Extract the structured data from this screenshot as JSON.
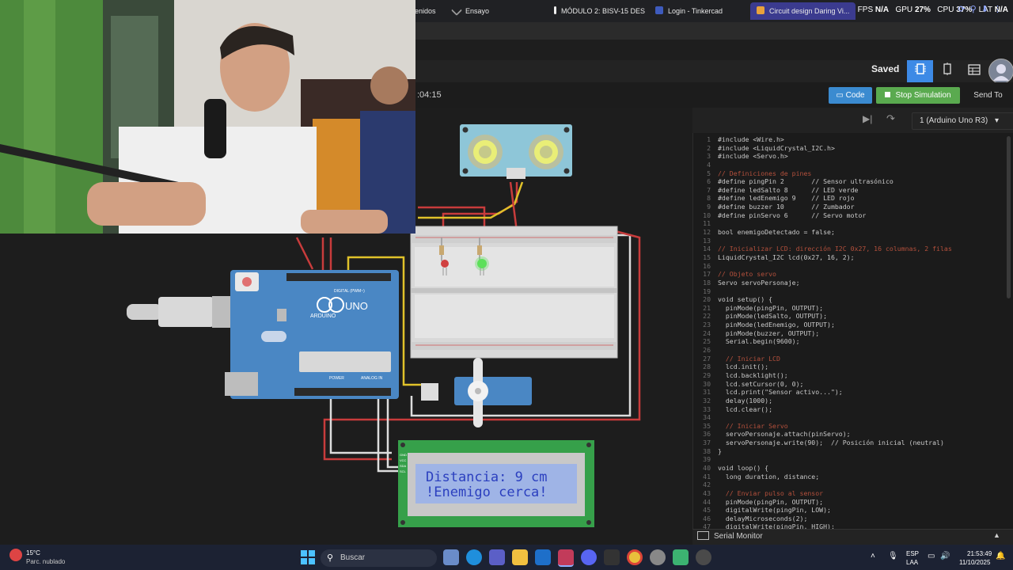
{
  "browser": {
    "tabs": [
      {
        "label": "enidos"
      },
      {
        "label": "Ensayo"
      },
      {
        "label": "MÓDULO 2: BISV-15 DES"
      },
      {
        "label": "Login - Tinkercad"
      },
      {
        "label": "Circuit design Daring Vi..."
      }
    ],
    "perf": {
      "fps_label": "FPS",
      "fps_value": "N/A",
      "gpu_label": "GPU",
      "gpu_value": "27%",
      "cpu_label": "CPU",
      "cpu_value": "37%",
      "lat_label": "LAT",
      "lat_value": "N/A"
    }
  },
  "tinkercad": {
    "saved_label": "Saved",
    "timer": ":04:15",
    "code_label": "Code",
    "stop_label": "Stop Simulation",
    "send_label": "Send To",
    "board_select": "1 (Arduino Uno R3)",
    "serial_monitor": "Serial Monitor",
    "lcd_line1": "Distancia:  9 cm",
    "lcd_line2": "!Enemigo cerca!",
    "arduino_labels": {
      "brand": "ARDUINO",
      "model": "UNO",
      "digital": "DIGITAL (PWM~)",
      "power": "POWER",
      "analog": "ANALOG IN"
    },
    "lcd_pins": [
      "GND",
      "VCC",
      "SDA",
      "SCL"
    ]
  },
  "code_lines": [
    {
      "n": "1",
      "t": "#include <Wire.h>",
      "c": false
    },
    {
      "n": "2",
      "t": "#include <LiquidCrystal_I2C.h>",
      "c": false
    },
    {
      "n": "3",
      "t": "#include <Servo.h>",
      "c": false
    },
    {
      "n": "4",
      "t": "",
      "c": false
    },
    {
      "n": "5",
      "t": "// Definiciones de pines",
      "c": true
    },
    {
      "n": "6",
      "t": "#define pingPin 2       // Sensor ultrasónico",
      "c": false
    },
    {
      "n": "7",
      "t": "#define ledSalto 8      // LED verde",
      "c": false
    },
    {
      "n": "8",
      "t": "#define ledEnemigo 9    // LED rojo",
      "c": false
    },
    {
      "n": "9",
      "t": "#define buzzer 10       // Zumbador",
      "c": false
    },
    {
      "n": "10",
      "t": "#define pinServo 6      // Servo motor",
      "c": false
    },
    {
      "n": "11",
      "t": "",
      "c": false
    },
    {
      "n": "12",
      "t": "bool enemigoDetectado = false;",
      "c": false
    },
    {
      "n": "13",
      "t": "",
      "c": false
    },
    {
      "n": "14",
      "t": "// Inicializar LCD: dirección I2C 0x27, 16 columnas, 2 filas",
      "c": true
    },
    {
      "n": "15",
      "t": "LiquidCrystal_I2C lcd(0x27, 16, 2);",
      "c": false
    },
    {
      "n": "16",
      "t": "",
      "c": false
    },
    {
      "n": "17",
      "t": "// Objeto servo",
      "c": true
    },
    {
      "n": "18",
      "t": "Servo servoPersonaje;",
      "c": false
    },
    {
      "n": "19",
      "t": "",
      "c": false
    },
    {
      "n": "20",
      "t": "void setup() {",
      "c": false
    },
    {
      "n": "21",
      "t": "  pinMode(pingPin, OUTPUT);",
      "c": false
    },
    {
      "n": "22",
      "t": "  pinMode(ledSalto, OUTPUT);",
      "c": false
    },
    {
      "n": "23",
      "t": "  pinMode(ledEnemigo, OUTPUT);",
      "c": false
    },
    {
      "n": "24",
      "t": "  pinMode(buzzer, OUTPUT);",
      "c": false
    },
    {
      "n": "25",
      "t": "  Serial.begin(9600);",
      "c": false
    },
    {
      "n": "26",
      "t": "",
      "c": false
    },
    {
      "n": "27",
      "t": "  // Iniciar LCD",
      "c": true
    },
    {
      "n": "28",
      "t": "  lcd.init();",
      "c": false
    },
    {
      "n": "29",
      "t": "  lcd.backlight();",
      "c": false
    },
    {
      "n": "30",
      "t": "  lcd.setCursor(0, 0);",
      "c": false
    },
    {
      "n": "31",
      "t": "  lcd.print(\"Sensor activo...\");",
      "c": false
    },
    {
      "n": "32",
      "t": "  delay(1000);",
      "c": false
    },
    {
      "n": "33",
      "t": "  lcd.clear();",
      "c": false
    },
    {
      "n": "34",
      "t": "",
      "c": false
    },
    {
      "n": "35",
      "t": "  // Iniciar Servo",
      "c": true
    },
    {
      "n": "36",
      "t": "  servoPersonaje.attach(pinServo);",
      "c": false
    },
    {
      "n": "37",
      "t": "  servoPersonaje.write(90);  // Posición inicial (neutral)",
      "c": false
    },
    {
      "n": "38",
      "t": "}",
      "c": false
    },
    {
      "n": "39",
      "t": "",
      "c": false
    },
    {
      "n": "40",
      "t": "void loop() {",
      "c": false
    },
    {
      "n": "41",
      "t": "  long duration, distance;",
      "c": false
    },
    {
      "n": "42",
      "t": "",
      "c": false
    },
    {
      "n": "43",
      "t": "  // Enviar pulso al sensor",
      "c": true
    },
    {
      "n": "44",
      "t": "  pinMode(pingPin, OUTPUT);",
      "c": false
    },
    {
      "n": "45",
      "t": "  digitalWrite(pingPin, LOW);",
      "c": false
    },
    {
      "n": "46",
      "t": "  delayMicroseconds(2);",
      "c": false
    },
    {
      "n": "47",
      "t": "  digitalWrite(pingPin, HIGH);",
      "c": false
    }
  ],
  "taskbar": {
    "weather_temp": "15°C",
    "weather_desc": "Parc. nublado",
    "search_placeholder": "Buscar",
    "lang_line1": "ESP",
    "lang_line2": "LAA",
    "time": "21:53:49",
    "date": "11/10/2025"
  },
  "colors": {
    "accent_blue": "#3d8ae6",
    "sim_green": "#5aaa4f",
    "lcd_bg": "#9fb4e6",
    "lcd_text": "#2b3fbf",
    "board_blue": "#4a87c4"
  }
}
